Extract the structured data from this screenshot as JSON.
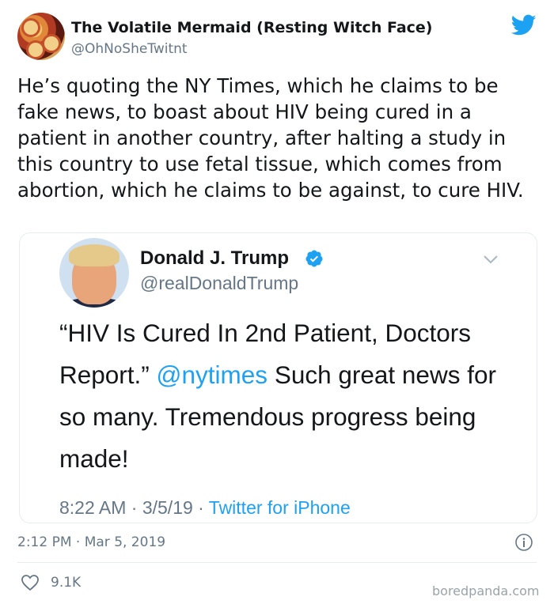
{
  "author": {
    "display_name": "The Volatile Mermaid (Resting Witch Face)",
    "handle": "@OhNoSheTwitnt"
  },
  "tweet": {
    "text": "He’s quoting the NY Times, which he claims to be fake news, to boast about HIV being cured in a patient in another country, after halting a study in this country to use fetal tissue, which comes from abortion, which he claims to be against, to cure HIV.",
    "timestamp": "2:12 PM · Mar 5, 2019",
    "likes": "9.1K"
  },
  "quoted_tweet": {
    "display_name": "Donald J. Trump",
    "handle": "@realDonaldTrump",
    "text_before": "“HIV Is Cured In 2nd Patient, Doctors Report.” ",
    "mention": "@nytimes",
    "text_after": "  Such great news for so many. Tremendous progress being made!",
    "time": "8:22 AM · 3/5/19 · ",
    "source": "Twitter for iPhone"
  },
  "watermark": "boredpanda.com",
  "colors": {
    "twitter_blue": "#1da1f2",
    "secondary_text": "#657786",
    "border": "#e6ecf0"
  },
  "icons": [
    "twitter-bird-icon",
    "verified-badge-icon",
    "chevron-down-icon",
    "info-icon",
    "heart-icon"
  ]
}
